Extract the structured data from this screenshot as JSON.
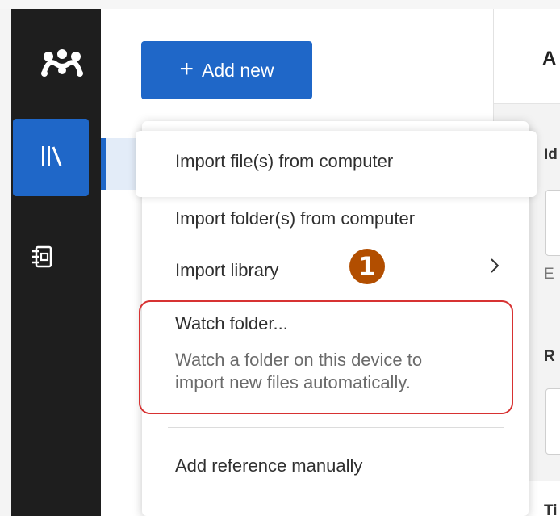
{
  "sidebar": {
    "logo_icon": "mendeley-logo-icon",
    "items": [
      {
        "icon": "library-icon",
        "active": true
      },
      {
        "icon": "notebook-icon",
        "active": false
      }
    ],
    "accent_color": "#1f67c8"
  },
  "toolbar": {
    "add_new_label": "Add new",
    "add_new_icon": "plus-icon"
  },
  "menu": {
    "import_files": "Import file(s) from computer",
    "import_folders": "Import folder(s) from computer",
    "import_library": "Import library",
    "import_library_icon": "chevron-right-icon",
    "watch_folder": "Watch folder...",
    "watch_folder_desc_line1": "Watch a folder on this device to",
    "watch_folder_desc_line2": "import new files automatically.",
    "add_reference": "Add reference manually"
  },
  "annotation": {
    "step_number": "1",
    "badge_color": "#b24e00",
    "highlight_color": "#d73232"
  },
  "details_pane": {
    "heading_fragment": "A",
    "label1_fragment": "Id",
    "hint_fragment": "E",
    "label2_fragment": "R",
    "label3_fragment": "Ti"
  }
}
